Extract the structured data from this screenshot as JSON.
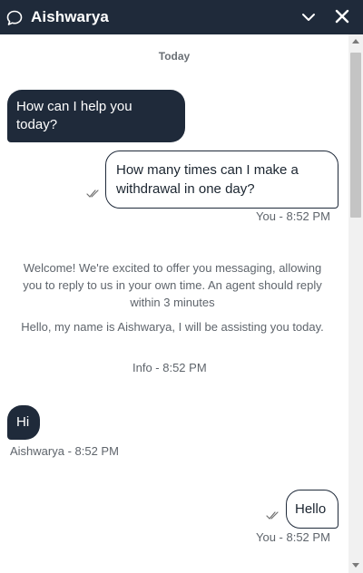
{
  "header": {
    "title": "Aishwarya",
    "icons": [
      "chat-bubble-icon",
      "chevron-down-icon",
      "close-icon"
    ],
    "background": "#1f2a3a"
  },
  "conversation": {
    "day_label": "Today",
    "messages": [
      {
        "sender": "agent",
        "text": "How can I help you today?"
      },
      {
        "sender": "user",
        "text": "How many times can I make a withdrawal in one day?",
        "meta": "You - 8:52 PM"
      },
      {
        "sender": "info",
        "text1": "Welcome! We're excited to offer you messaging, allowing you to reply to us in your own time. An agent should reply within 3 minutes",
        "text2": "Hello, my name is Aishwarya, I will be assisting you today.",
        "meta": "Info - 8:52 PM"
      },
      {
        "sender": "agent",
        "text": "Hi",
        "meta": "Aishwarya - 8:52 PM"
      },
      {
        "sender": "user",
        "text": "Hello",
        "meta": "You - 8:52 PM"
      }
    ]
  },
  "colors": {
    "agent_bubble": "#1f2a3a",
    "user_bubble_border": "#1f2a3a",
    "meta_text": "#5f656c"
  }
}
